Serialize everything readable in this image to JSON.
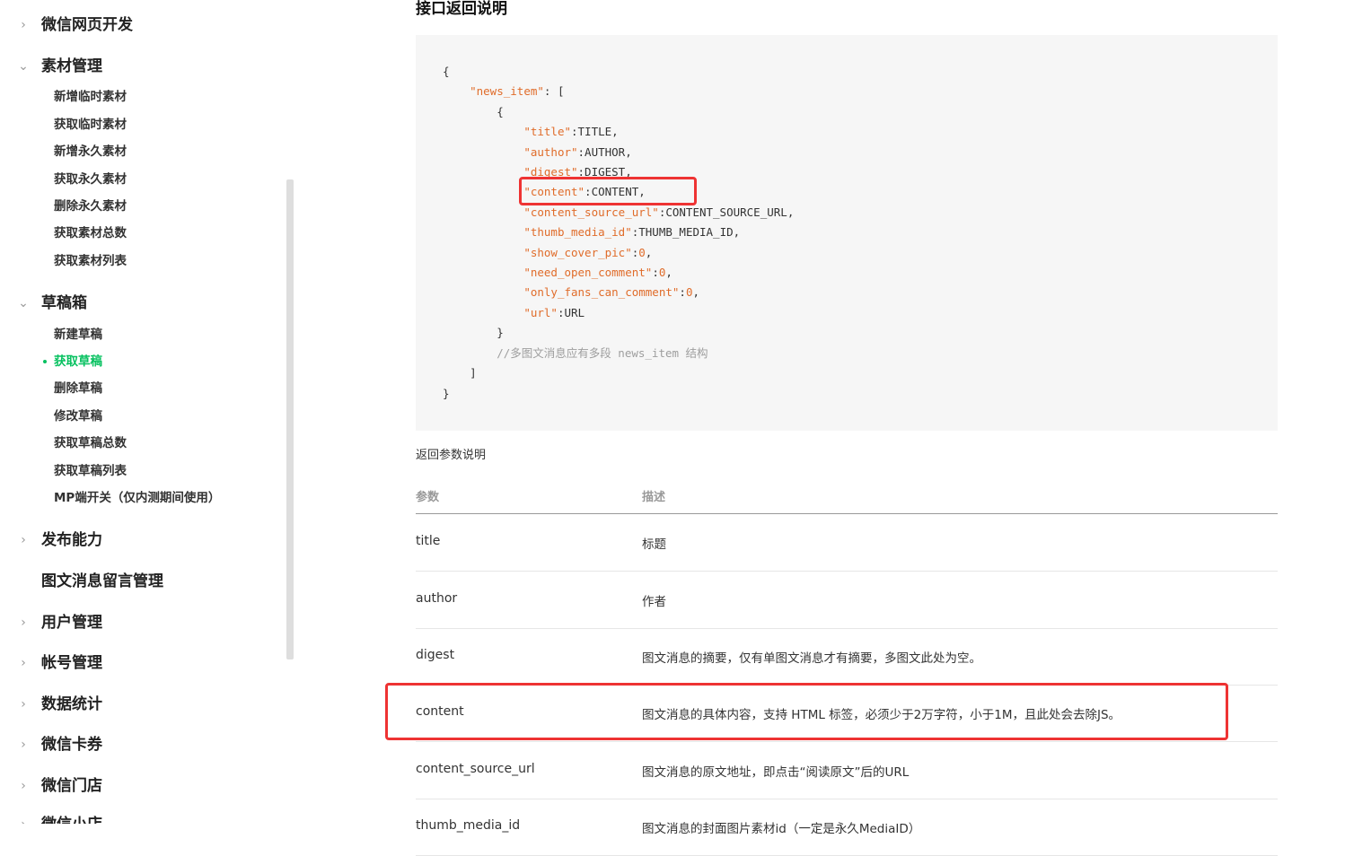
{
  "sidebar": {
    "groups": [
      {
        "label": "微信网页开发",
        "chevron": "chevron-right-icon"
      },
      {
        "label": "素材管理",
        "chevron": "chevron-down-icon"
      },
      {
        "label": "草稿箱",
        "chevron": "chevron-down-icon"
      },
      {
        "label": "发布能力",
        "chevron": "chevron-right-icon"
      },
      {
        "label": "图文消息留言管理",
        "chevron": ""
      },
      {
        "label": "用户管理",
        "chevron": "chevron-right-icon"
      },
      {
        "label": "帐号管理",
        "chevron": "chevron-right-icon"
      },
      {
        "label": "数据统计",
        "chevron": "chevron-right-icon"
      },
      {
        "label": "微信卡券",
        "chevron": "chevron-right-icon"
      },
      {
        "label": "微信门店",
        "chevron": "chevron-right-icon"
      },
      {
        "label": "微信小店",
        "chevron": "chevron-right-icon"
      }
    ],
    "material_items": [
      "新增临时素材",
      "获取临时素材",
      "新增永久素材",
      "获取永久素材",
      "删除永久素材",
      "获取素材总数",
      "获取素材列表"
    ],
    "draft_items": [
      "新建草稿",
      "获取草稿",
      "删除草稿",
      "修改草稿",
      "获取草稿总数",
      "获取草稿列表",
      "MP端开关（仅内测期间使用）"
    ],
    "active_item": "获取草稿",
    "accent_color": "#07c160"
  },
  "main": {
    "section_title": "接口返回说明",
    "code_comment": "//多图文消息应有多段 news_item 结构",
    "params_note": "返回参数说明",
    "table": {
      "headers": [
        "参数",
        "描述"
      ],
      "rows": [
        {
          "param": "title",
          "desc": "标题"
        },
        {
          "param": "author",
          "desc": "作者"
        },
        {
          "param": "digest",
          "desc": "图文消息的摘要，仅有单图文消息才有摘要，多图文此处为空。"
        },
        {
          "param": "content",
          "desc": "图文消息的具体内容，支持 HTML 标签，必须少于2万字符，小于1M，且此处会去除JS。"
        },
        {
          "param": "content_source_url",
          "desc": "图文消息的原文地址，即点击“阅读原文”后的URL"
        },
        {
          "param": "thumb_media_id",
          "desc": "图文消息的封面图片素材id（一定是永久MediaID）"
        }
      ]
    },
    "highlight_color": "#e33333"
  }
}
